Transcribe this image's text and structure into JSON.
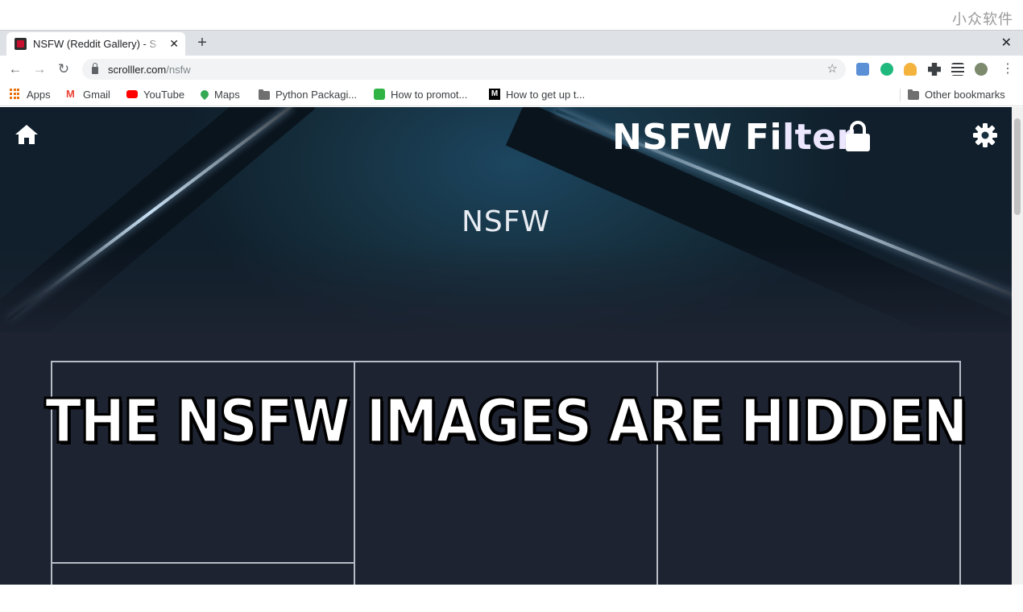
{
  "watermark": "小众软件",
  "browser": {
    "tab_title": "NSFW (Reddit Gallery) - S",
    "tab_close": "✕",
    "new_tab": "+",
    "window_close": "✕",
    "url_host": "scrolller.com",
    "url_path": "/nsfw",
    "nav": {
      "back": "←",
      "forward": "→",
      "reload": "↻"
    },
    "star": "☆",
    "menu": "⋮"
  },
  "bookmarks": {
    "items": [
      {
        "label": "Apps",
        "icon": "apps-grid-icon"
      },
      {
        "label": "Gmail",
        "icon": "gmail-icon"
      },
      {
        "label": "YouTube",
        "icon": "youtube-icon"
      },
      {
        "label": "Maps",
        "icon": "maps-icon"
      },
      {
        "label": "Python Packagi...",
        "icon": "folder-icon"
      },
      {
        "label": "How to promot...",
        "icon": "page-icon"
      },
      {
        "label": "How to get up t...",
        "icon": "medium-icon"
      }
    ],
    "other": "Other bookmarks"
  },
  "page": {
    "overlay_title_a": "NSFW Fi",
    "overlay_title_b": "lter",
    "heading": "NSFW",
    "banner": "THE NSFW IMAGES ARE HIDDEN"
  },
  "colors": {
    "page_bg": "#1d2331",
    "hero_bg": "#16303f",
    "grid_border": "#b8bcc6",
    "youtube_red": "#ff0000",
    "gmail_red": "#ea4335"
  }
}
